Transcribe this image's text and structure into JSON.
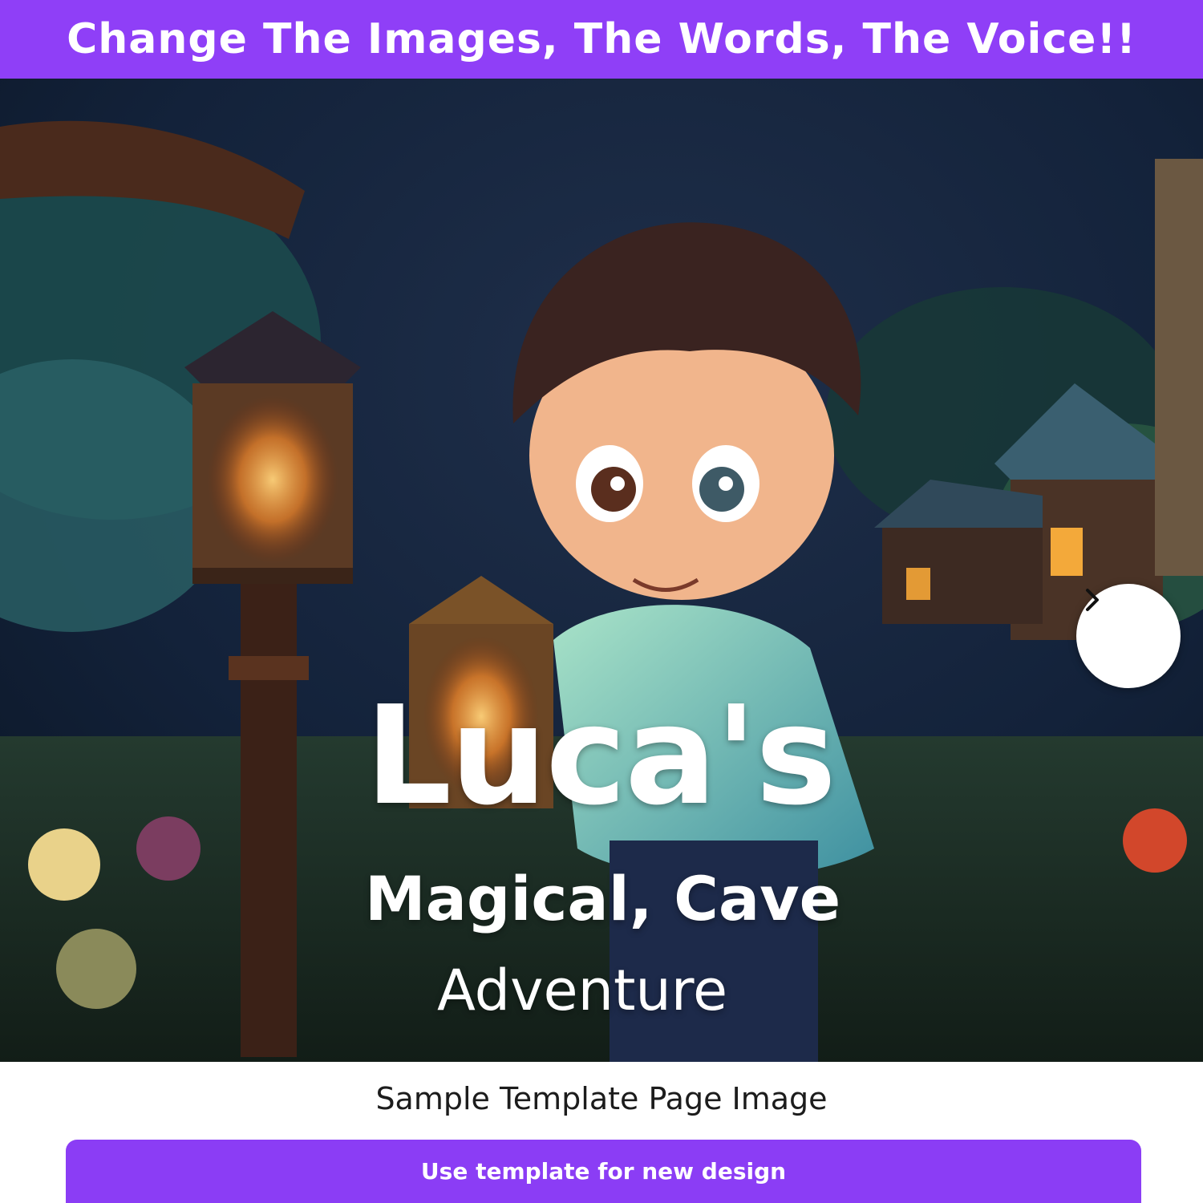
{
  "banner": {
    "text": "Change The Images, The Words, The Voice!!",
    "color": "#8f3ff7"
  },
  "cover": {
    "title_line1": "Luca's",
    "title_line2": "Magical, Cave",
    "title_line3": "Adventure"
  },
  "carousel": {
    "next_icon": "chevron-right-icon"
  },
  "caption": "Sample Template Page Image",
  "cta": {
    "label": "Use template for new design",
    "color": "#8b3df5"
  }
}
